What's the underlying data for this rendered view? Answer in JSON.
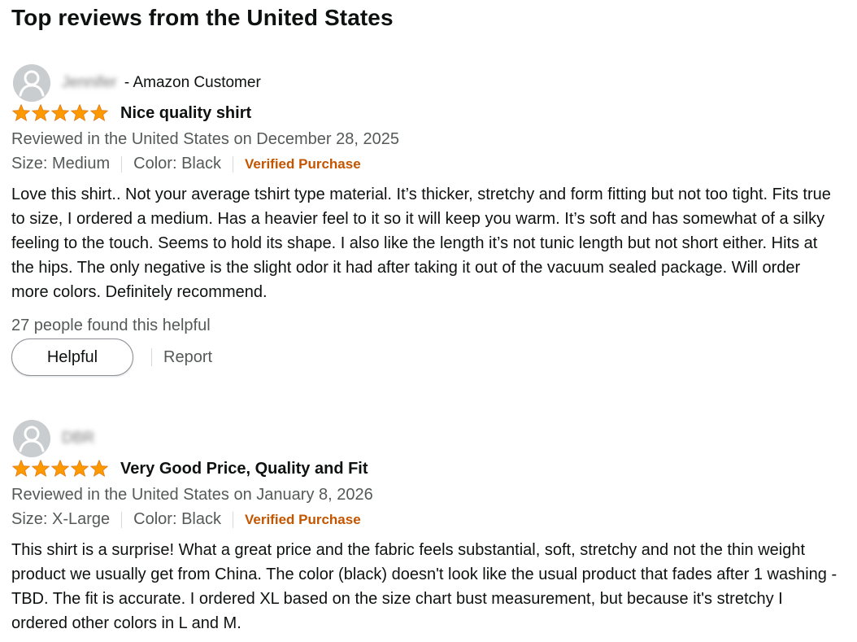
{
  "section": {
    "title": "Top reviews from the United States"
  },
  "colors": {
    "star": "#ff9900",
    "verified": "#c45500",
    "secondary_text": "#565959",
    "avatar": "#c9cdcf"
  },
  "reviews": [
    {
      "reviewer_name": "Jennifer",
      "reviewer_suffix": " - Amazon Customer",
      "rating": 5,
      "rating_max": 5,
      "title": "Nice quality shirt",
      "date": "Reviewed in the United States on December 28, 2025",
      "size": "Size: Medium",
      "color": "Color: Black",
      "verified": "Verified Purchase",
      "body": "Love this shirt.. Not your average tshirt type material. It’s thicker, stretchy and form fitting but not too tight. Fits true to size, I ordered a medium. Has a heavier feel to it so it will keep you warm. It’s soft and has somewhat of a silky feeling to the touch. Seems to hold its shape. I also like the length it’s not tunic length but not short either. Hits at the hips. The only negative is the slight odor it had after taking it out of the vacuum sealed package. Will order more colors. Definitely recommend.",
      "helpful_count": "27 people found this helpful",
      "helpful_button": "Helpful",
      "report": "Report"
    },
    {
      "reviewer_name": "DBR",
      "reviewer_suffix": "",
      "rating": 5,
      "rating_max": 5,
      "title": "Very Good Price, Quality and Fit",
      "date": "Reviewed in the United States on January 8, 2026",
      "size": "Size: X-Large",
      "color": "Color: Black",
      "verified": "Verified Purchase",
      "body": "This shirt is a surprise! What a great price and the fabric feels substantial, soft, stretchy and not the thin weight product we usually get from China. The color (black) doesn't look like the usual product that fades after 1 washing - TBD. The fit is accurate. I ordered XL based on the size chart bust measurement, but because it's stretchy I ordered other colors in L and M."
    }
  ]
}
